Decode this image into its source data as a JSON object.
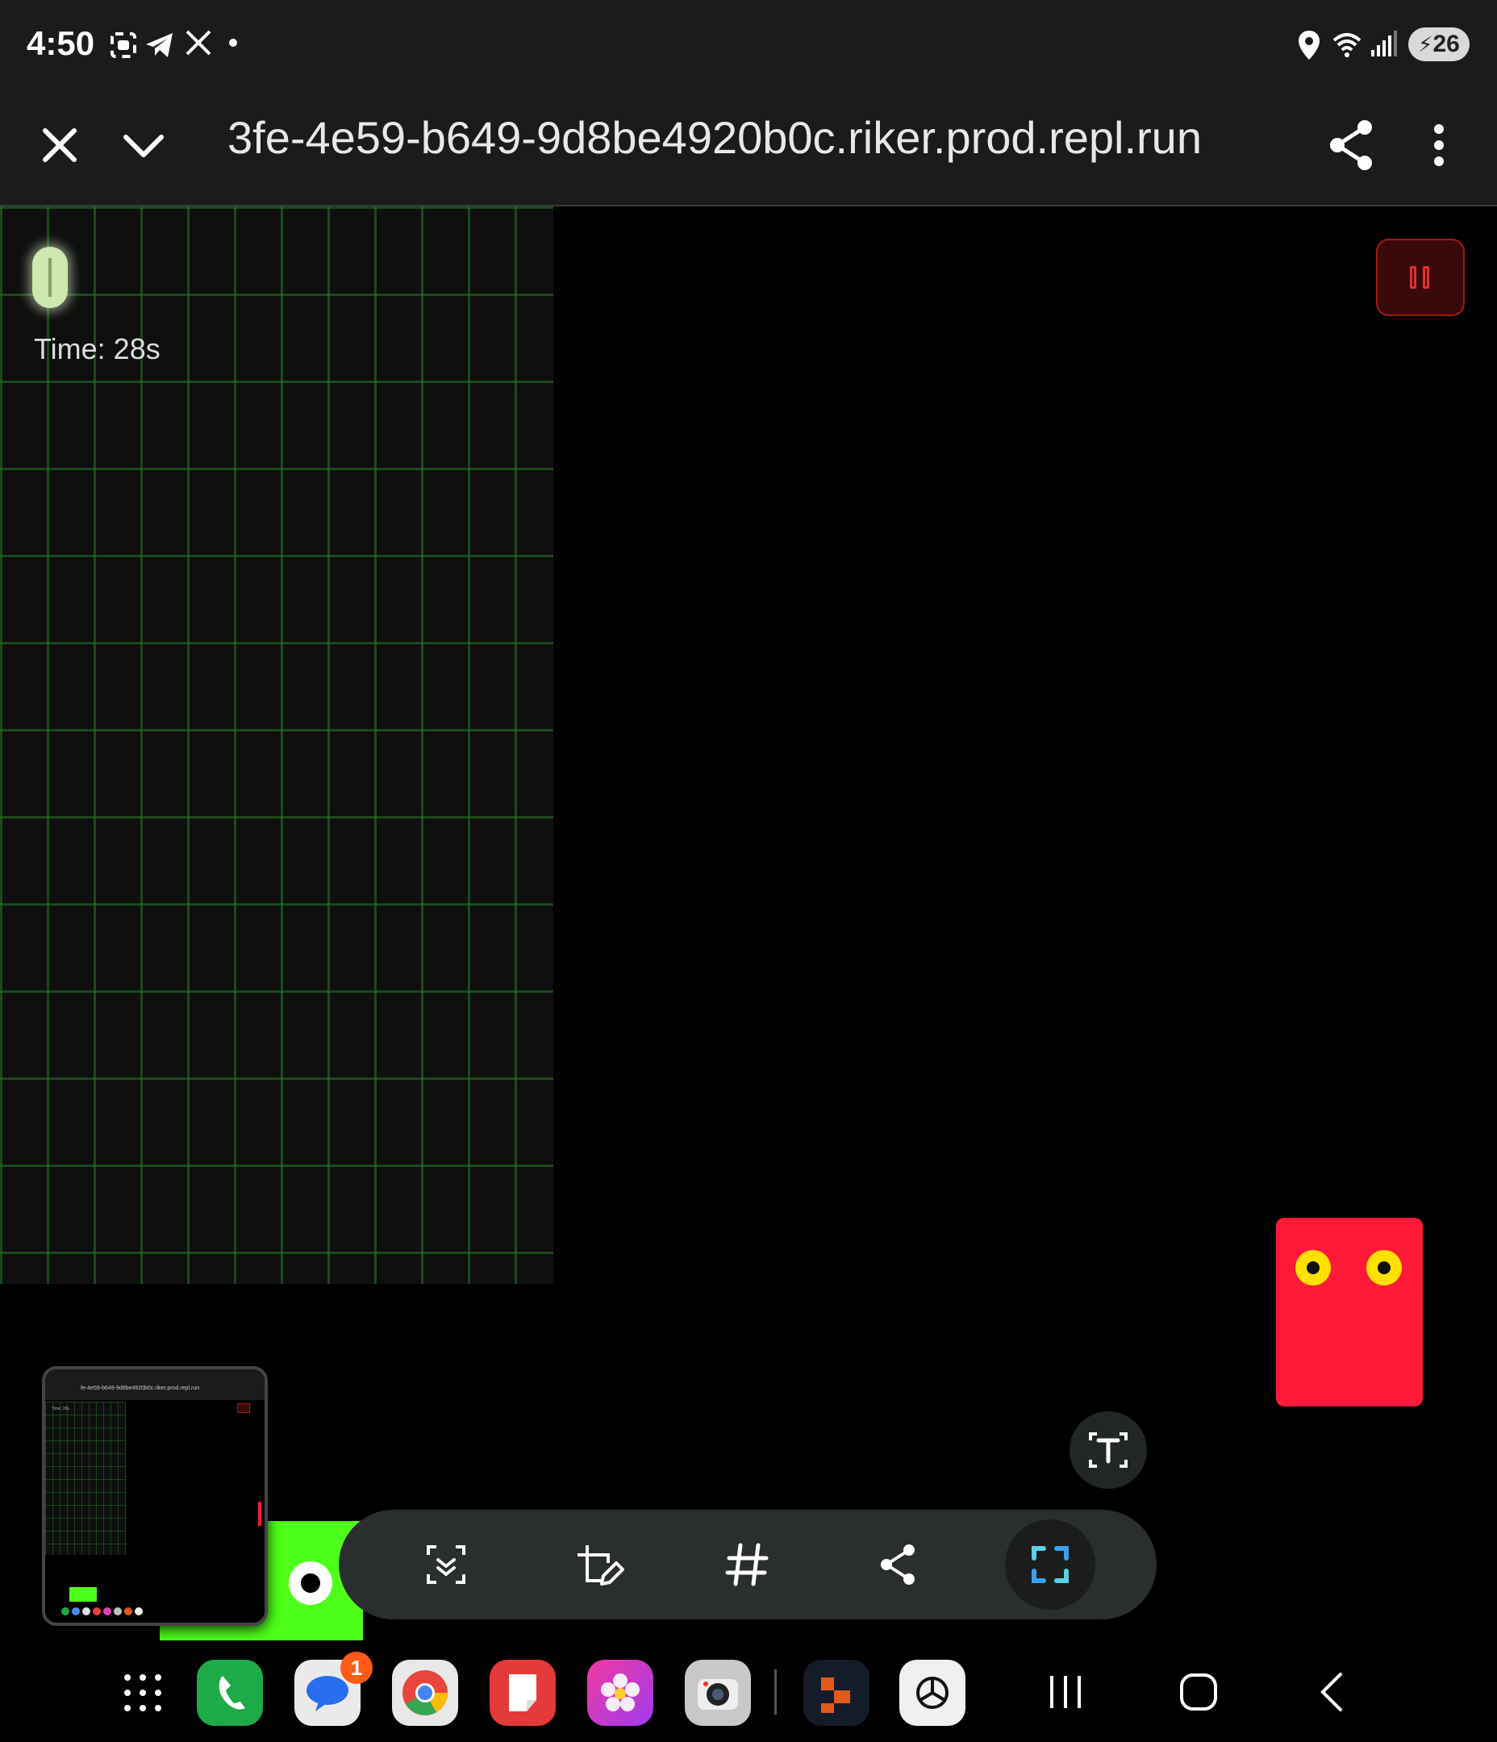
{
  "status_bar": {
    "time": "4:50",
    "battery": "26",
    "left_icons": [
      "screenshot-icon",
      "telegram-icon",
      "x-icon",
      "dot-icon"
    ],
    "right_icons": [
      "location-icon",
      "wifi-icon",
      "signal-icon",
      "battery-icon"
    ]
  },
  "browser": {
    "url": "3fe-4e59-b649-9d8be4920b0c.riker.prod.repl.run",
    "icons": [
      "close-icon",
      "chevron-down-icon",
      "share-icon",
      "more-icon"
    ]
  },
  "game": {
    "time_label": "Time: 28s",
    "colors": {
      "enemy": "#ff1a3a",
      "player_block": "#4dff1a",
      "eye": "#ffe000",
      "grid": "#1f6a1f",
      "pause": "#e03030"
    }
  },
  "thumbnail": {
    "url": "fe-4e59-b649-9d8be4920b0c.riker.prod.repl.run",
    "time_label": "Time: 28s"
  },
  "toolbar": {
    "icons": [
      "scroll-capture-icon",
      "edit-icon",
      "hashtag-icon",
      "share-icon",
      "crop-icon",
      "text-extract-icon"
    ]
  },
  "dock": {
    "apps": [
      "apps-grid",
      "phone",
      "messages",
      "chrome",
      "notes",
      "gallery",
      "camera",
      "office",
      "chatgpt"
    ],
    "messages_badge": "1",
    "nav": [
      "recents-icon",
      "home-icon",
      "back-icon"
    ]
  }
}
